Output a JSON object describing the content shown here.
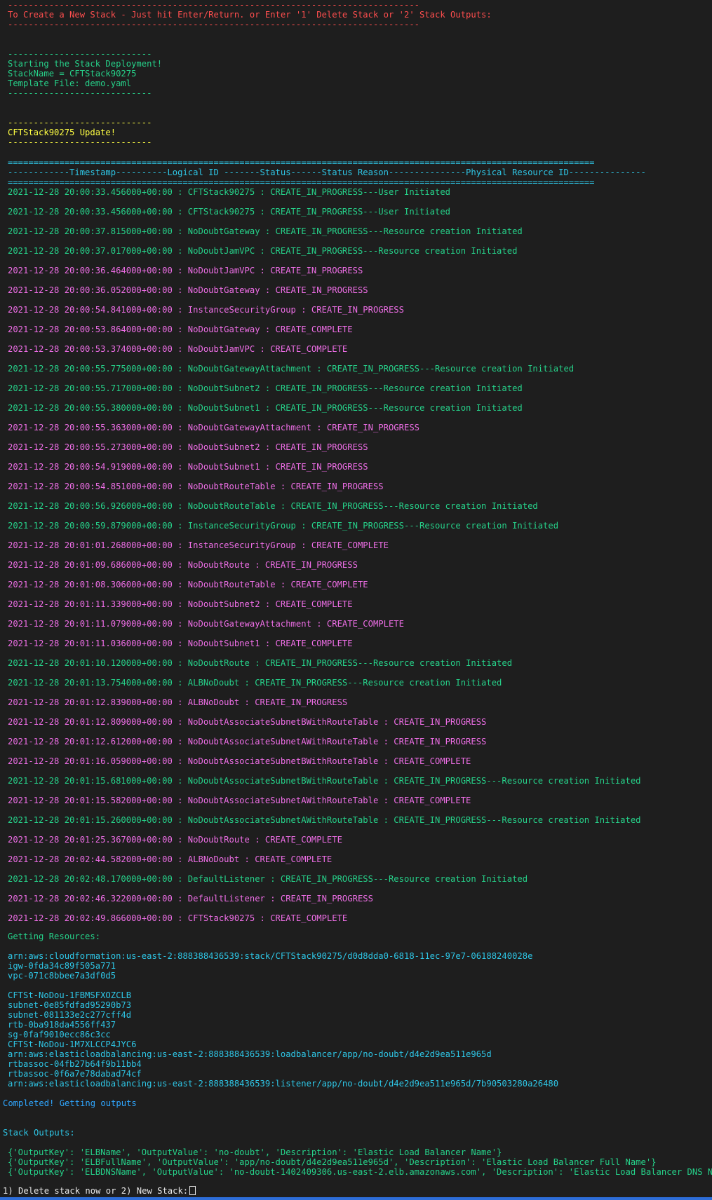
{
  "header": {
    "dash": "--------------------------------------------------------------------------------",
    "prompt": "To Create a New Stack - Just hit Enter/Return. or Enter '1' Delete Stack or '2' Stack Outputs:"
  },
  "deploy": {
    "dash": "----------------------------",
    "title": "Starting the Stack Deployment!",
    "stack_name": "StackName = CFTStack90275",
    "template": "Template File: demo.yaml"
  },
  "update": {
    "dash": "----------------------------",
    "title": "CFTStack90275 Update!"
  },
  "table": {
    "rule": "==================================================================================================================",
    "header": "------------Timestamp----------Logical ID -------Status------Status Reason---------------Physical Resource ID---------------"
  },
  "events": [
    {
      "text": "2021-12-28 20:00:33.456000+00:00 : CFTStack90275 : CREATE_IN_PROGRESS---User Initiated",
      "color": "green"
    },
    {
      "text": "2021-12-28 20:00:33.456000+00:00 : CFTStack90275 : CREATE_IN_PROGRESS---User Initiated",
      "color": "green"
    },
    {
      "text": "2021-12-28 20:00:37.815000+00:00 : NoDoubtGateway : CREATE_IN_PROGRESS---Resource creation Initiated",
      "color": "green"
    },
    {
      "text": "2021-12-28 20:00:37.017000+00:00 : NoDoubtJamVPC : CREATE_IN_PROGRESS---Resource creation Initiated",
      "color": "green"
    },
    {
      "text": "2021-12-28 20:00:36.464000+00:00 : NoDoubtJamVPC : CREATE_IN_PROGRESS",
      "color": "mag"
    },
    {
      "text": "2021-12-28 20:00:36.052000+00:00 : NoDoubtGateway : CREATE_IN_PROGRESS",
      "color": "mag"
    },
    {
      "text": "2021-12-28 20:00:54.841000+00:00 : InstanceSecurityGroup : CREATE_IN_PROGRESS",
      "color": "mag"
    },
    {
      "text": "2021-12-28 20:00:53.864000+00:00 : NoDoubtGateway : CREATE_COMPLETE",
      "color": "mag"
    },
    {
      "text": "2021-12-28 20:00:53.374000+00:00 : NoDoubtJamVPC : CREATE_COMPLETE",
      "color": "mag"
    },
    {
      "text": "2021-12-28 20:00:55.775000+00:00 : NoDoubtGatewayAttachment : CREATE_IN_PROGRESS---Resource creation Initiated",
      "color": "green"
    },
    {
      "text": "2021-12-28 20:00:55.717000+00:00 : NoDoubtSubnet2 : CREATE_IN_PROGRESS---Resource creation Initiated",
      "color": "green"
    },
    {
      "text": "2021-12-28 20:00:55.380000+00:00 : NoDoubtSubnet1 : CREATE_IN_PROGRESS---Resource creation Initiated",
      "color": "green"
    },
    {
      "text": "2021-12-28 20:00:55.363000+00:00 : NoDoubtGatewayAttachment : CREATE_IN_PROGRESS",
      "color": "mag"
    },
    {
      "text": "2021-12-28 20:00:55.273000+00:00 : NoDoubtSubnet2 : CREATE_IN_PROGRESS",
      "color": "mag"
    },
    {
      "text": "2021-12-28 20:00:54.919000+00:00 : NoDoubtSubnet1 : CREATE_IN_PROGRESS",
      "color": "mag"
    },
    {
      "text": "2021-12-28 20:00:54.851000+00:00 : NoDoubtRouteTable : CREATE_IN_PROGRESS",
      "color": "mag"
    },
    {
      "text": "2021-12-28 20:00:56.926000+00:00 : NoDoubtRouteTable : CREATE_IN_PROGRESS---Resource creation Initiated",
      "color": "green"
    },
    {
      "text": "2021-12-28 20:00:59.879000+00:00 : InstanceSecurityGroup : CREATE_IN_PROGRESS---Resource creation Initiated",
      "color": "green"
    },
    {
      "text": "2021-12-28 20:01:01.268000+00:00 : InstanceSecurityGroup : CREATE_COMPLETE",
      "color": "mag"
    },
    {
      "text": "2021-12-28 20:01:09.686000+00:00 : NoDoubtRoute : CREATE_IN_PROGRESS",
      "color": "mag"
    },
    {
      "text": "2021-12-28 20:01:08.306000+00:00 : NoDoubtRouteTable : CREATE_COMPLETE",
      "color": "mag"
    },
    {
      "text": "2021-12-28 20:01:11.339000+00:00 : NoDoubtSubnet2 : CREATE_COMPLETE",
      "color": "mag"
    },
    {
      "text": "2021-12-28 20:01:11.079000+00:00 : NoDoubtGatewayAttachment : CREATE_COMPLETE",
      "color": "mag"
    },
    {
      "text": "2021-12-28 20:01:11.036000+00:00 : NoDoubtSubnet1 : CREATE_COMPLETE",
      "color": "mag"
    },
    {
      "text": "2021-12-28 20:01:10.120000+00:00 : NoDoubtRoute : CREATE_IN_PROGRESS---Resource creation Initiated",
      "color": "green"
    },
    {
      "text": "2021-12-28 20:01:13.754000+00:00 : ALBNoDoubt : CREATE_IN_PROGRESS---Resource creation Initiated",
      "color": "green"
    },
    {
      "text": "2021-12-28 20:01:12.839000+00:00 : ALBNoDoubt : CREATE_IN_PROGRESS",
      "color": "mag"
    },
    {
      "text": "2021-12-28 20:01:12.809000+00:00 : NoDoubtAssociateSubnetBWithRouteTable : CREATE_IN_PROGRESS",
      "color": "mag"
    },
    {
      "text": "2021-12-28 20:01:12.612000+00:00 : NoDoubtAssociateSubnetAWithRouteTable : CREATE_IN_PROGRESS",
      "color": "mag"
    },
    {
      "text": "2021-12-28 20:01:16.059000+00:00 : NoDoubtAssociateSubnetBWithRouteTable : CREATE_COMPLETE",
      "color": "mag"
    },
    {
      "text": "2021-12-28 20:01:15.681000+00:00 : NoDoubtAssociateSubnetBWithRouteTable : CREATE_IN_PROGRESS---Resource creation Initiated",
      "color": "green"
    },
    {
      "text": "2021-12-28 20:01:15.582000+00:00 : NoDoubtAssociateSubnetAWithRouteTable : CREATE_COMPLETE",
      "color": "mag"
    },
    {
      "text": "2021-12-28 20:01:15.260000+00:00 : NoDoubtAssociateSubnetAWithRouteTable : CREATE_IN_PROGRESS---Resource creation Initiated",
      "color": "green"
    },
    {
      "text": "2021-12-28 20:01:25.367000+00:00 : NoDoubtRoute : CREATE_COMPLETE",
      "color": "mag"
    },
    {
      "text": "2021-12-28 20:02:44.582000+00:00 : ALBNoDoubt : CREATE_COMPLETE",
      "color": "mag"
    },
    {
      "text": "2021-12-28 20:02:48.170000+00:00 : DefaultListener : CREATE_IN_PROGRESS---Resource creation Initiated",
      "color": "green"
    },
    {
      "text": "2021-12-28 20:02:46.322000+00:00 : DefaultListener : CREATE_IN_PROGRESS",
      "color": "mag"
    },
    {
      "text": "2021-12-28 20:02:49.866000+00:00 : CFTStack90275 : CREATE_COMPLETE",
      "color": "mag"
    }
  ],
  "resources": {
    "heading": "Getting Resources:",
    "group1": [
      "arn:aws:cloudformation:us-east-2:888388436539:stack/CFTStack90275/d0d8dda0-6818-11ec-97e7-06188240028e",
      "igw-0fda34c89f505a771",
      "vpc-071c8bbee7a3df0d5"
    ],
    "group2": [
      "CFTSt-NoDou-1FBMSFXOZCLB",
      "subnet-0e85fdfad95290b73",
      "subnet-081133e2c277cff4d",
      "rtb-0ba918da4556ff437",
      "sg-0faf9010ecc86c3cc",
      "CFTSt-NoDou-1M7XLCCP4JYC6",
      "arn:aws:elasticloadbalancing:us-east-2:888388436539:loadbalancer/app/no-doubt/d4e2d9ea511e965d",
      "rtbassoc-04fb27b64f9b11bb4",
      "rtbassoc-0f6a7e78dabad74cf",
      "arn:aws:elasticloadbalancing:us-east-2:888388436539:listener/app/no-doubt/d4e2d9ea511e965d/7b90503280a26480"
    ]
  },
  "completed": "Completed! Getting outputs",
  "outputs": {
    "heading": "Stack Outputs:",
    "lines": [
      "{'OutputKey': 'ELBName', 'OutputValue': 'no-doubt', 'Description': 'Elastic Load Balancer Name'}",
      "{'OutputKey': 'ELBFullName', 'OutputValue': 'app/no-doubt/d4e2d9ea511e965d', 'Description': 'Elastic Load Balancer Full Name'}",
      "{'OutputKey': 'ELBDNSName', 'OutputValue': 'no-doubt-1402409306.us-east-2.elb.amazonaws.com', 'Description': 'Elastic Load Balancer DNS Name'}"
    ]
  },
  "final_prompt": "1) Delete stack now or 2) New Stack:"
}
